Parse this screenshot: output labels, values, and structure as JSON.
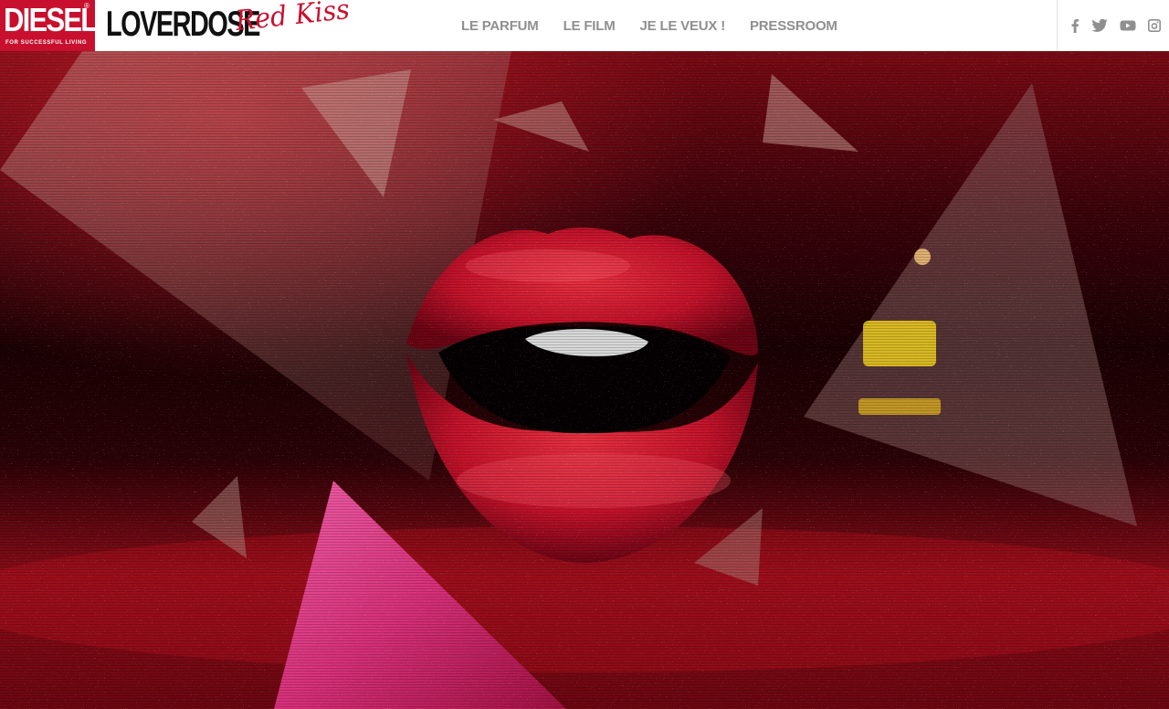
{
  "brand": {
    "name": "DIESEL",
    "tagline": "FOR SUCCESSFUL LIVING",
    "reg_mark": "®",
    "color": "#c8102e"
  },
  "product": {
    "name": "LOVERDOSE",
    "script_name": "Red Kiss"
  },
  "nav": {
    "items": [
      {
        "label": "LE PARFUM"
      },
      {
        "label": "LE FILM"
      },
      {
        "label": "JE LE VEUX !"
      },
      {
        "label": "PRESSROOM"
      }
    ],
    "color": "#8f8f8f"
  },
  "social": {
    "icons": [
      "facebook-icon",
      "twitter-icon",
      "youtube-icon",
      "instagram-icon"
    ],
    "color": "#8f8f8f"
  },
  "hero": {
    "subject": "red-lips-glitter-triangles",
    "palette": {
      "background": "#2a0006",
      "lips": "#c4122a",
      "glitter": "#e8c3a8",
      "pink_triangle": "#e0307a",
      "amber": "#f0d020"
    }
  }
}
